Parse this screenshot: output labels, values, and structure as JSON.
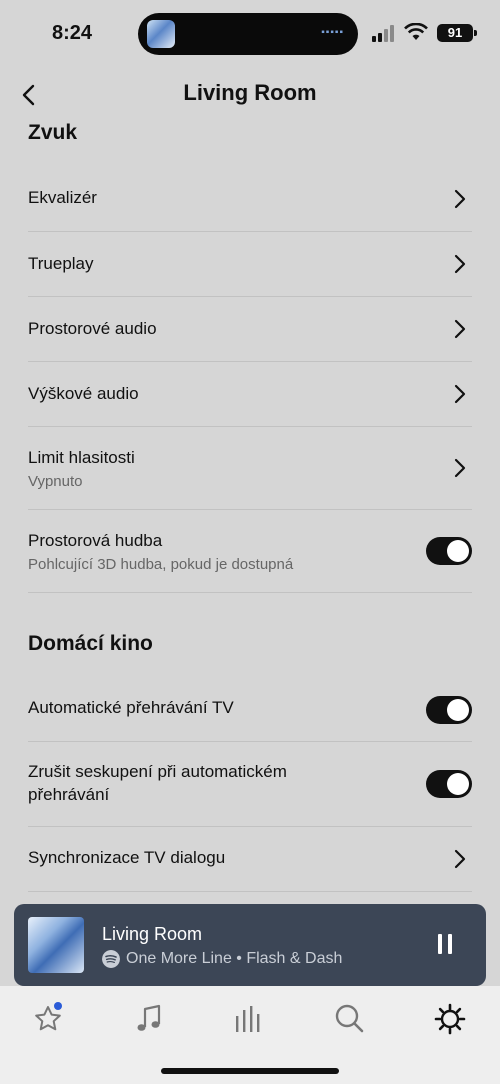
{
  "status_bar": {
    "time": "8:24",
    "battery": "91"
  },
  "nav": {
    "title": "Living Room"
  },
  "sections": {
    "sound": {
      "title": "Zvuk",
      "rows": [
        {
          "title": "Ekvalizér"
        },
        {
          "title": "Trueplay"
        },
        {
          "title": "Prostorové audio"
        },
        {
          "title": "Výškové audio"
        },
        {
          "title": "Limit hlasitosti",
          "subtitle": "Vypnuto"
        },
        {
          "title": "Prostorová hudba",
          "subtitle": "Pohlcující 3D hudba, pokud je dostupná",
          "toggle": true
        }
      ]
    },
    "home_theater": {
      "title": "Domácí kino",
      "rows": [
        {
          "title": "Automatické přehrávání TV",
          "toggle": true
        },
        {
          "title_line1": "Zrušit seskupení při automatickém",
          "title_line2": "přehrávání",
          "toggle": true
        },
        {
          "title": "Synchronizace TV dialogu"
        }
      ]
    }
  },
  "now_playing": {
    "room": "Living Room",
    "track": "One More Line • Flash & Dash",
    "state": "playing"
  },
  "tab_bar": {
    "tabs": [
      "favorites-icon",
      "music-icon",
      "rooms-icon",
      "search-icon",
      "settings-icon"
    ],
    "active": "settings-icon",
    "badge_color": "#2a5bd7"
  },
  "colors": {
    "background": "#d6d6d6",
    "now_playing_bg": "#3c4656",
    "toggle_on": "#111111"
  }
}
